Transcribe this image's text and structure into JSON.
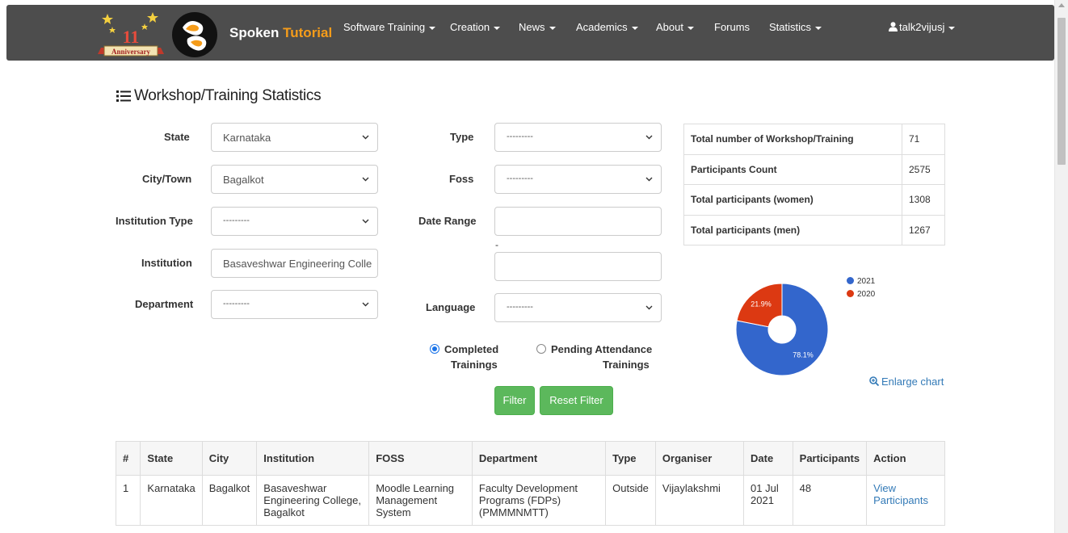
{
  "nav": {
    "anniversary_number": "11",
    "anniversary_label": "Anniversary",
    "brand_part1": "Spoken",
    "brand_part2": "Tutorial",
    "items": [
      "Software Training",
      "Creation",
      "News",
      "Academics",
      "About",
      "Forums",
      "Statistics"
    ],
    "user": "talk2vijusj"
  },
  "page": {
    "title": "Workshop/Training Statistics"
  },
  "filters": {
    "state_label": "State",
    "state_value": "Karnataka",
    "city_label": "City/Town",
    "city_value": "Bagalkot",
    "inst_type_label": "Institution Type",
    "inst_type_value": "---------",
    "institution_label": "Institution",
    "institution_value": "Basaveshwar Engineering Colle",
    "department_label": "Department",
    "department_value": "---------",
    "type_label": "Type",
    "type_value": "---------",
    "foss_label": "Foss",
    "foss_value": "---------",
    "date_range_label": "Date Range",
    "date_from": "",
    "date_to": "",
    "date_sep": "-",
    "language_label": "Language",
    "language_value": "---------",
    "radio_completed_line1": "Completed",
    "radio_completed_line2": "Trainings",
    "radio_pending_line1": "Pending Attendance",
    "radio_pending_line2": "Trainings",
    "filter_button": "Filter",
    "reset_button": "Reset Filter"
  },
  "stats": [
    {
      "label": "Total number of Workshop/Training",
      "value": "71"
    },
    {
      "label": "Participants Count",
      "value": "2575"
    },
    {
      "label": "Total participants (women)",
      "value": "1308"
    },
    {
      "label": "Total participants (men)",
      "value": "1267"
    }
  ],
  "chart_data": {
    "type": "pie",
    "series": [
      {
        "name": "2021",
        "value": 78.1,
        "label": "78.1%",
        "color": "#3366cc"
      },
      {
        "name": "2020",
        "value": 21.9,
        "label": "21.9%",
        "color": "#dc3912"
      }
    ],
    "legend": "top-right",
    "donut": true
  },
  "enlarge_chart": "Enlarge chart",
  "table": {
    "headers": [
      "#",
      "State",
      "City",
      "Institution",
      "FOSS",
      "Department",
      "Type",
      "Organiser",
      "Date",
      "Participants",
      "Action"
    ],
    "rows": [
      {
        "num": "1",
        "state": "Karnataka",
        "city": "Bagalkot",
        "institution_lines": [
          "Basaveshwar",
          "Engineering College,",
          "Bagalkot"
        ],
        "foss_lines": [
          "Moodle Learning",
          "Management System"
        ],
        "department_lines": [
          "Faculty Development",
          "Programs (FDPs)",
          "(PMMMNMTT)"
        ],
        "type": "Outside",
        "organiser": "Vijaylakshmi",
        "date_lines": [
          "01 Jul",
          "2021"
        ],
        "participants": "48",
        "action_lines": [
          "View",
          "Participants"
        ]
      }
    ]
  },
  "colors": {
    "navbar": "#4d4d4d",
    "brand_accent": "#f59c1a",
    "button": "#5cb85c",
    "link": "#337ab7"
  }
}
